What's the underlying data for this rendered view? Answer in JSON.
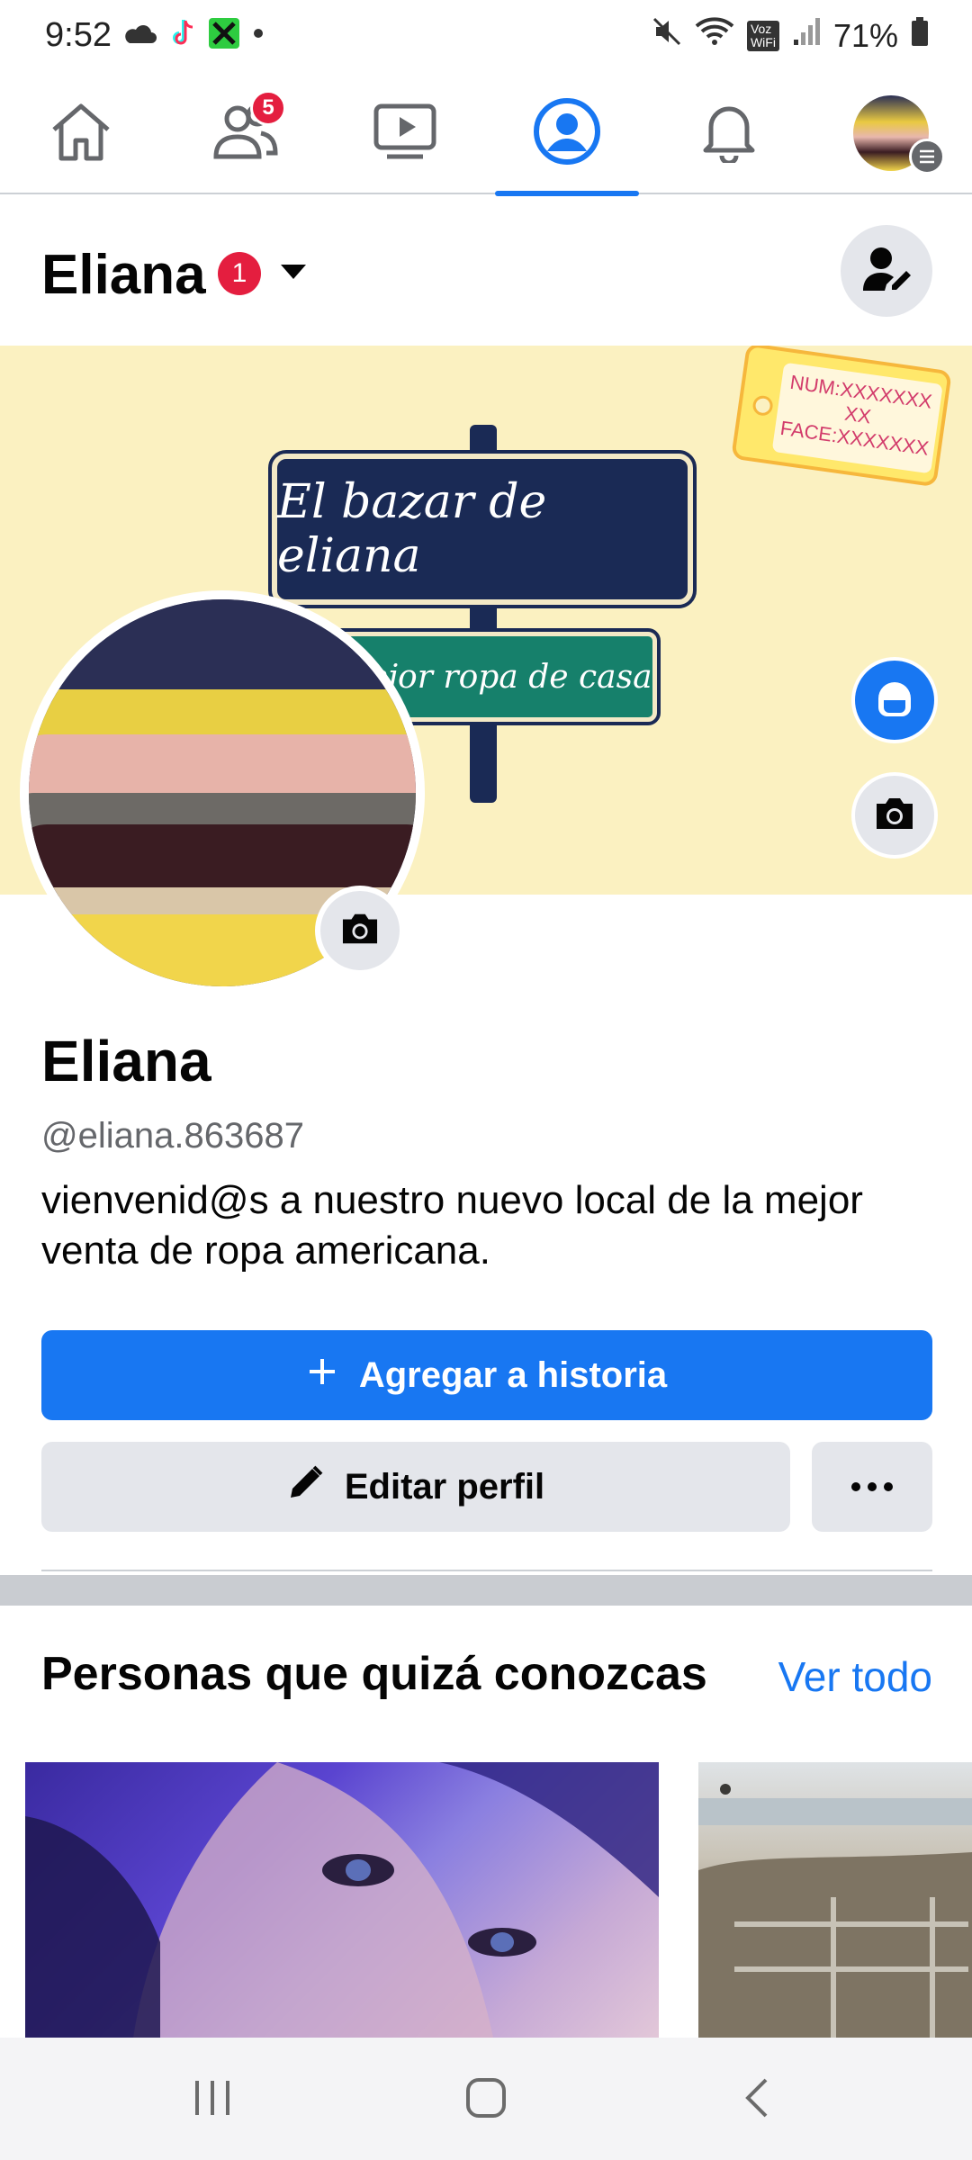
{
  "status_bar": {
    "time": "9:52",
    "battery": "71%",
    "network_label": "VoLTE WiFi"
  },
  "top_nav": {
    "friends_badge": "5",
    "tabs": [
      "home-icon",
      "friends-icon",
      "watch-icon",
      "profile-icon",
      "notifications-icon",
      "menu-avatar"
    ],
    "active_tab": "profile"
  },
  "profile_header": {
    "name": "Eliana",
    "badge_count": "1"
  },
  "cover": {
    "sign_top_text": "El bazar de eliana",
    "sign_bottom_text": "mejor ropa de casa",
    "tag_text_line1": "NUM:XXXXXXX",
    "tag_text_line2": "XX",
    "tag_text_line3": "FACE:XXXXXXX"
  },
  "profile": {
    "name": "Eliana",
    "handle": "@eliana.863687",
    "bio": "vienvenid@s a nuestro nuevo local de la mejor venta de ropa americana."
  },
  "actions": {
    "primary_label": "Agregar a historia",
    "secondary_label": "Editar perfil"
  },
  "pymk": {
    "title": "Personas que quizá conozcas",
    "link": "Ver todo"
  },
  "colors": {
    "accent": "#1877f2",
    "badge_red": "#e41e3f",
    "surface_gray": "#e4e6eb",
    "cover_bg": "#fbf1c1"
  }
}
